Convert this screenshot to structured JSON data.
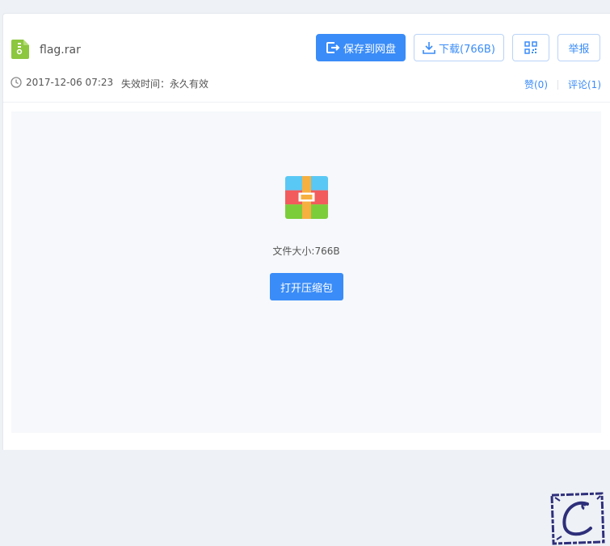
{
  "file": {
    "name": "flag.rar",
    "icon": "zip-file-icon",
    "size_text": "文件大小:766B"
  },
  "toolbar": {
    "save_label": "保存到网盘",
    "download_label": "下载(766B)",
    "report_label": "举报"
  },
  "meta": {
    "upload_time": "2017-12-06 07:23",
    "expire_text": "失效时间：永久有效"
  },
  "social": {
    "like_label": "赞(0)",
    "comment_label": "评论(1)"
  },
  "preview": {
    "open_label": "打开压缩包"
  },
  "colors": {
    "accent": "#3a8cf8",
    "file_icon_green": "#8dc63f"
  }
}
